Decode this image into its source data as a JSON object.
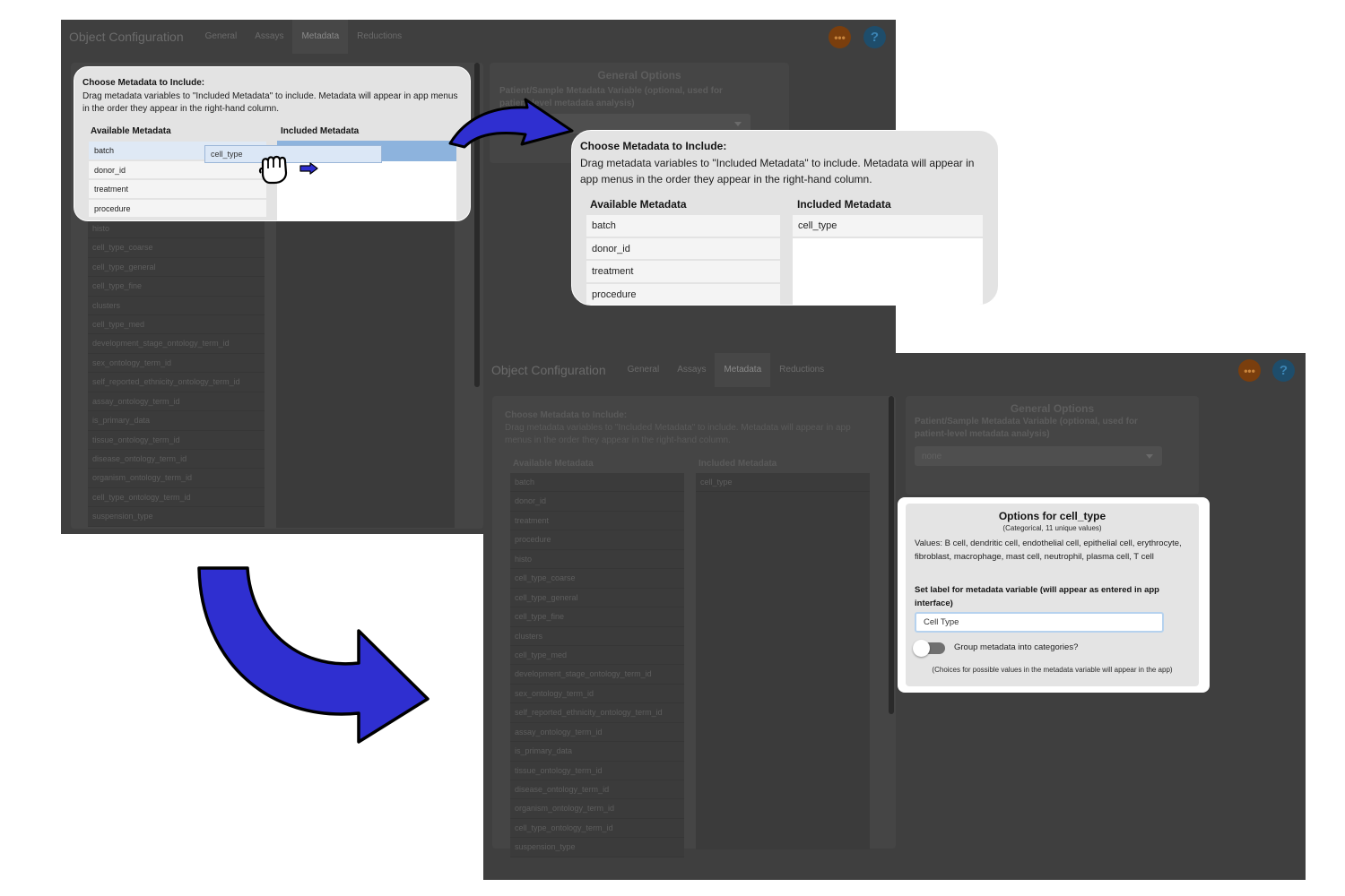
{
  "app": {
    "title": "Object Configuration",
    "tabs": [
      "General",
      "Assays",
      "Metadata",
      "Reductions"
    ],
    "active_tab": "Metadata",
    "more_button": "•••",
    "help_button": "?"
  },
  "metadata_panel": {
    "heading": "Choose Metadata to Include:",
    "instructions": "Drag metadata variables to \"Included Metadata\" to include. Metadata will appear in app menus in the order they appear in the right-hand column.",
    "available_header": "Available Metadata",
    "included_header": "Included Metadata",
    "available_items": [
      "batch",
      "donor_id",
      "treatment",
      "procedure",
      "histo",
      "cell_type_coarse",
      "cell_type_general",
      "cell_type_fine",
      "clusters",
      "cell_type_med",
      "development_stage_ontology_term_id",
      "sex_ontology_term_id",
      "self_reported_ethnicity_ontology_term_id",
      "assay_ontology_term_id",
      "is_primary_data",
      "tissue_ontology_term_id",
      "disease_ontology_term_id",
      "organism_ontology_term_id",
      "cell_type_ontology_term_id",
      "suspension_type"
    ],
    "included_items": [
      "cell_type"
    ],
    "dragged_item": "cell_type"
  },
  "general_options": {
    "title": "General Options",
    "patient_label": "Patient/Sample Metadata Variable (optional, used for patient-level metadata analysis)",
    "patient_value": "none"
  },
  "variable_options": {
    "title": "Options for cell_type",
    "subtitle": "(Categorical, 11 unique values)",
    "values": "Values: B cell, dendritic cell, endothelial cell, epithelial cell, erythrocyte, fibroblast, macrophage, mast cell, neutrophil, plasma cell, T cell",
    "label_prompt": "Set label for metadata variable (will appear as entered in app interface)",
    "label_value": "Cell Type",
    "group_toggle_label": "Group metadata into categories?",
    "group_toggle_on": false,
    "note": "(Choices for possible values in the metadata variable will appear in the app)"
  },
  "colors": {
    "arrow_fill": "#2f2fd0",
    "arrow_stroke": "#000000",
    "app_background": "#3f3f3f",
    "highlight": "#8db3dd"
  },
  "icons": {
    "drag": "grab-hand-icon",
    "drag_direction": "right-arrow-icon"
  }
}
